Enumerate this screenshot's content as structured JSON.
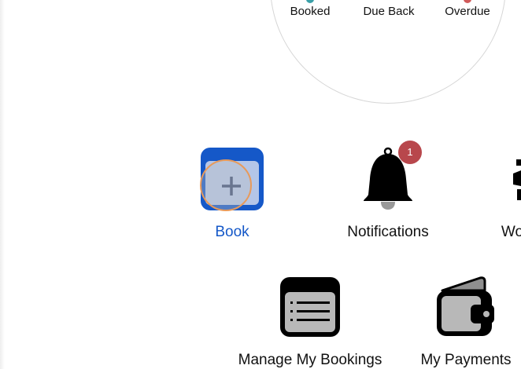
{
  "summary": {
    "stats": [
      {
        "label": "Booked",
        "color": "#3aa0a8"
      },
      {
        "label": "Due Back",
        "color": "#f0a33a"
      },
      {
        "label": "Overdue",
        "color": "#d05a5a"
      }
    ]
  },
  "tiles": {
    "book": {
      "label": "Book",
      "icon": "calendar-plus-icon",
      "color": "#1558c8"
    },
    "notifications": {
      "label": "Notifications",
      "icon": "bell-icon",
      "badge": "1",
      "badge_color": "#b8474c"
    },
    "partial": {
      "label": "Wo",
      "icon": "partial-icon"
    },
    "manage_bookings": {
      "label": "Manage My Bookings",
      "icon": "list-icon"
    },
    "payments": {
      "label": "My Payments",
      "icon": "wallet-icon"
    }
  }
}
